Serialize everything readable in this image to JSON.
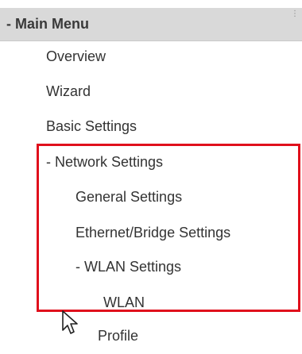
{
  "main_menu": {
    "header_label": "- Main Menu",
    "items": [
      {
        "label": "Overview"
      },
      {
        "label": "Wizard"
      },
      {
        "label": "Basic Settings"
      },
      {
        "label": "- Network Settings"
      },
      {
        "label": "General Settings"
      },
      {
        "label": "Ethernet/Bridge Settings"
      },
      {
        "label": "- WLAN Settings"
      },
      {
        "label": "WLAN"
      },
      {
        "label": "Profile"
      }
    ]
  },
  "colors": {
    "header_bg": "#d9d9d9",
    "highlight_border": "#e0101c",
    "text": "#333333"
  },
  "icons": {
    "cursor": "mouse-pointer-icon"
  }
}
